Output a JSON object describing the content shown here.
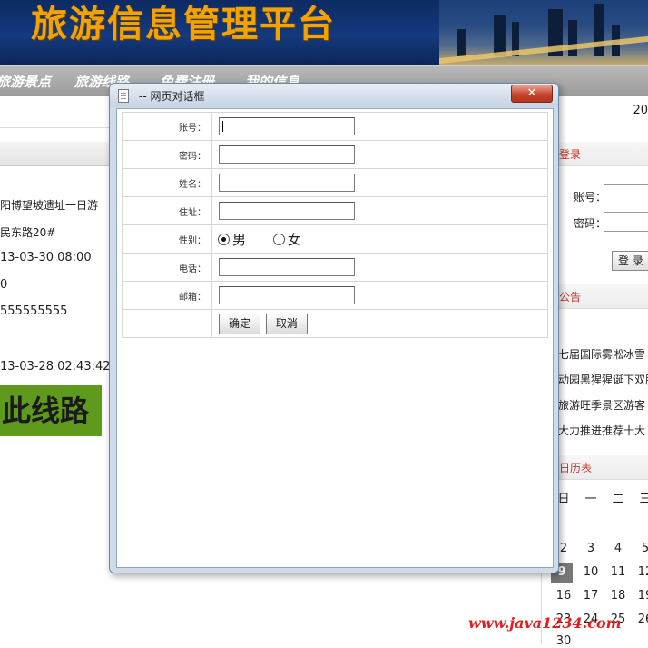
{
  "banner": {
    "title": "旅游信息管理平台"
  },
  "nav": {
    "items": [
      "旅游景点",
      "旅游线路",
      "免费注册",
      "我的信息"
    ]
  },
  "subbar": {
    "year": "20"
  },
  "detail": {
    "line1": "阳博望坡遗址一日游",
    "line2": "民东路20#",
    "line3": "13-03-30 08:00",
    "line4": "0",
    "line5": "555555555",
    "line6": "13-03-28 02:43:42",
    "route_banner": "此线路"
  },
  "login_panel": {
    "title": "登录",
    "account_label": "账号：",
    "password_label": "密码：",
    "login_button": "登 录"
  },
  "notice_panel": {
    "title": "公告",
    "items": [
      "七届国际雾凇冰雪",
      "动园黑猩猩诞下双胞",
      "旅游旺季景区游客",
      "大力推进推荐十大"
    ]
  },
  "calendar_panel": {
    "title": "日历表",
    "weekdays": [
      "日",
      "一",
      "二",
      "三"
    ],
    "rows": [
      [
        "2",
        "3",
        "4",
        "5"
      ],
      [
        "9",
        "10",
        "11",
        "12"
      ],
      [
        "16",
        "17",
        "18",
        "19"
      ],
      [
        "23",
        "24",
        "25",
        "26"
      ],
      [
        "30"
      ]
    ],
    "today": "9"
  },
  "watermark": "www.java1234.com",
  "dialog": {
    "title": "-- 网页对话框",
    "close_symbol": "✕",
    "fields": [
      {
        "label": "账号：",
        "value": ""
      },
      {
        "label": "密码：",
        "value": ""
      },
      {
        "label": "姓名：",
        "value": ""
      },
      {
        "label": "住址：",
        "value": ""
      },
      {
        "label": "性别："
      },
      {
        "label": "电话：",
        "value": ""
      },
      {
        "label": "邮箱：",
        "value": ""
      }
    ],
    "gender_options": [
      "男",
      "女"
    ],
    "gender_selected": "男",
    "confirm_button": "确定",
    "cancel_button": "取消"
  }
}
